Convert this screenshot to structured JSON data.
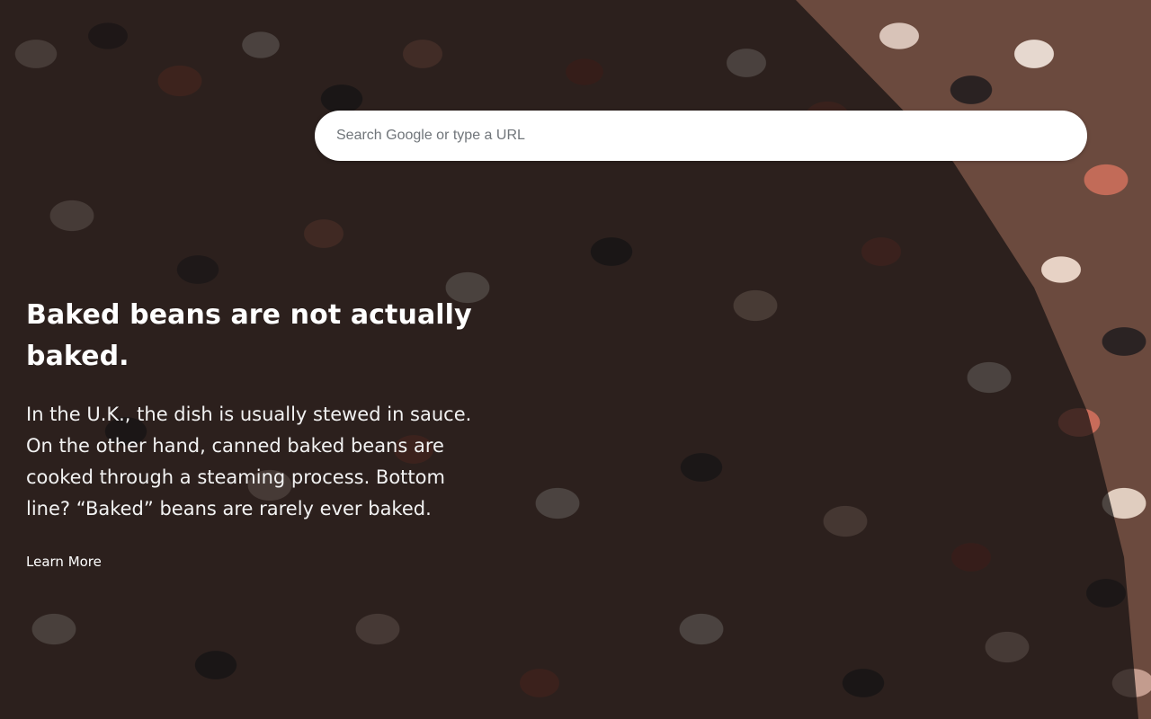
{
  "search": {
    "placeholder": "Search Google or type a URL"
  },
  "fact": {
    "title": "Baked beans are not actually baked.",
    "body": "In the U.K., the dish is usually stewed in sauce. On the other hand, canned baked beans are cooked through a steaming process. Bottom line? “Baked” beans are rarely ever baked.",
    "link_label": "Learn More"
  },
  "colors": {
    "overlay": "#141010",
    "search_bg": "#ffffff",
    "text": "#ffffff"
  }
}
